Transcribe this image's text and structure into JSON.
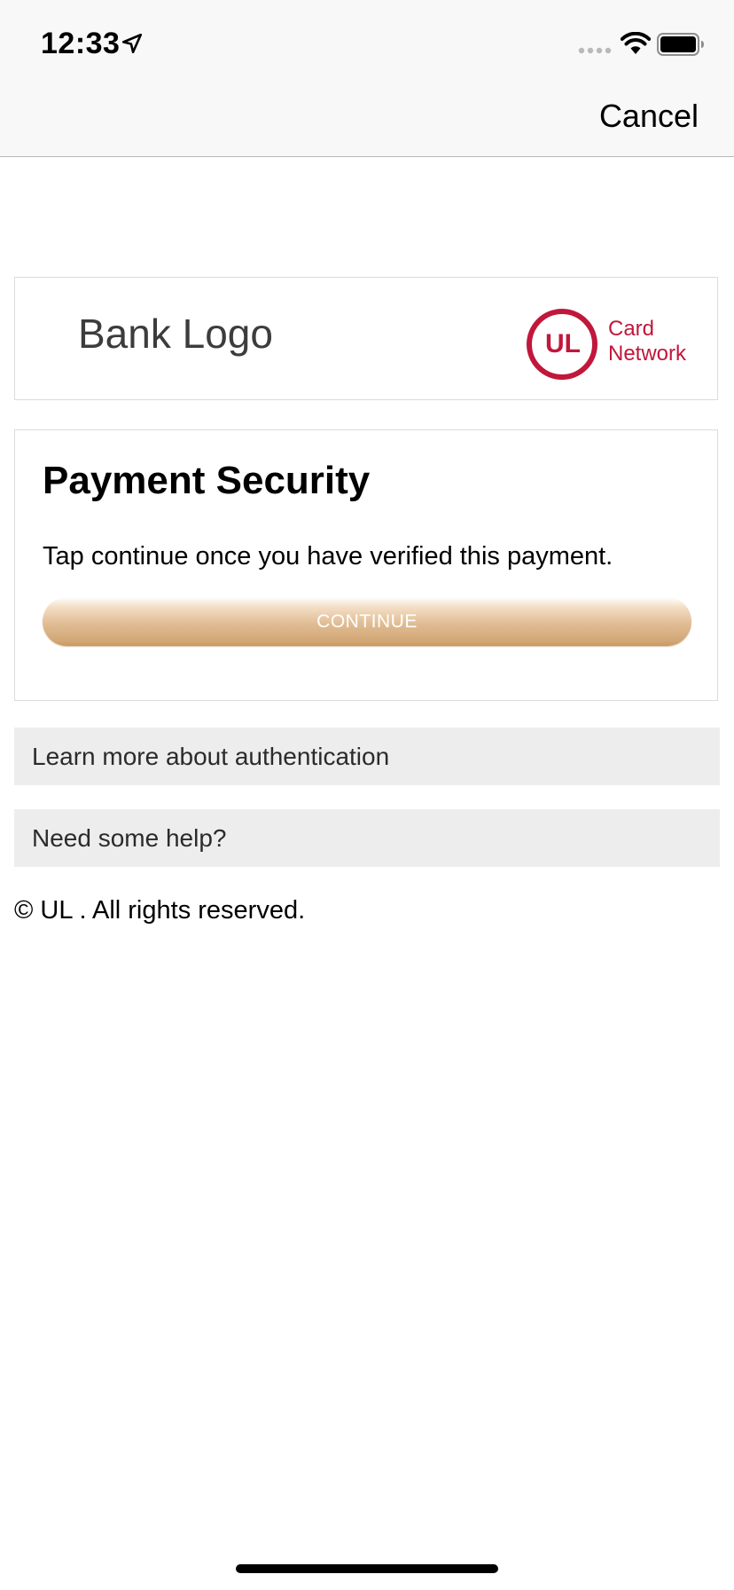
{
  "status_bar": {
    "time": "12:33",
    "icons": [
      "location-arrow-icon",
      "signal-dots-icon",
      "wifi-icon",
      "battery-icon"
    ]
  },
  "nav": {
    "cancel_label": "Cancel"
  },
  "logos": {
    "bank_logo_text": "Bank Logo",
    "network_mark": "UL",
    "network_label_line1": "Card",
    "network_label_line2": "Network",
    "network_color": "#c0173b"
  },
  "card": {
    "title": "Payment Security",
    "instructions": "Tap continue once you have verified this payment.",
    "continue_label": "CONTINUE",
    "button_color": "#d9b183"
  },
  "info_rows": {
    "learn_more": "Learn more about authentication",
    "help": "Need some help?"
  },
  "footer": {
    "copyright": "© UL . All rights reserved."
  }
}
